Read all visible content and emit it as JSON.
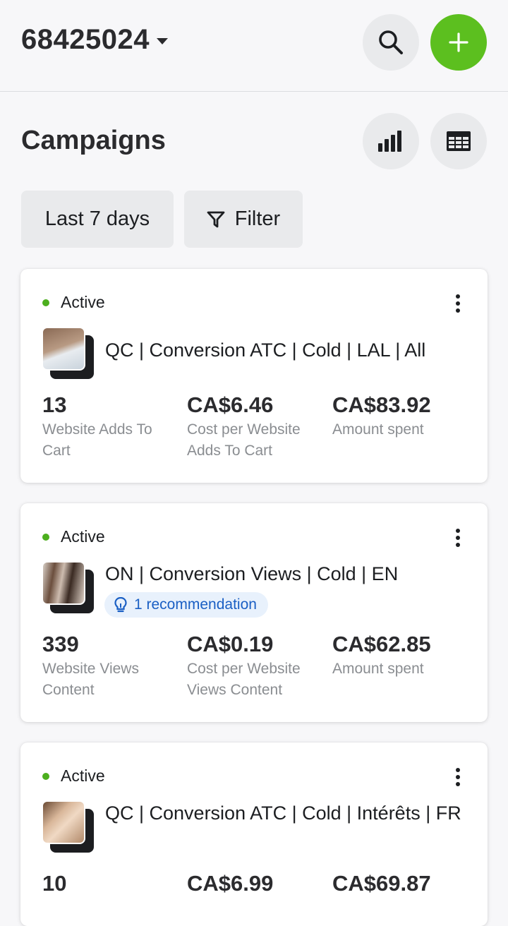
{
  "header": {
    "account_id": "68425024",
    "icons": {
      "search": "search-icon",
      "add": "plus-icon",
      "dropdown": "caret-down-icon"
    },
    "accent_color": "#5cbf1f"
  },
  "page": {
    "title": "Campaigns",
    "icons": {
      "chart": "bar-chart-icon",
      "table": "table-icon"
    }
  },
  "filters": {
    "date_range": "Last 7 days",
    "filter_label": "Filter",
    "filter_icon": "funnel-icon"
  },
  "campaigns": [
    {
      "status": "Active",
      "name": "QC | Conversion ATC | Cold | LAL | All",
      "metrics": [
        {
          "value": "13",
          "label": "Website Adds To Cart"
        },
        {
          "value": "CA$6.46",
          "label": "Cost per Website Adds To Cart"
        },
        {
          "value": "CA$83.92",
          "label": "Amount spent"
        }
      ]
    },
    {
      "status": "Active",
      "name": "ON | Conversion Views | Cold | EN",
      "recommendation": "1 recommendation",
      "metrics": [
        {
          "value": "339",
          "label": "Website Views Content"
        },
        {
          "value": "CA$0.19",
          "label": "Cost per Website Views Content"
        },
        {
          "value": "CA$62.85",
          "label": "Amount spent"
        }
      ]
    },
    {
      "status": "Active",
      "name": "QC | Conversion ATC | Cold | Intérêts | FR",
      "metrics": [
        {
          "value": "10",
          "label": ""
        },
        {
          "value": "CA$6.99",
          "label": ""
        },
        {
          "value": "CA$69.87",
          "label": ""
        }
      ]
    }
  ],
  "status_color": "#4caf1e"
}
